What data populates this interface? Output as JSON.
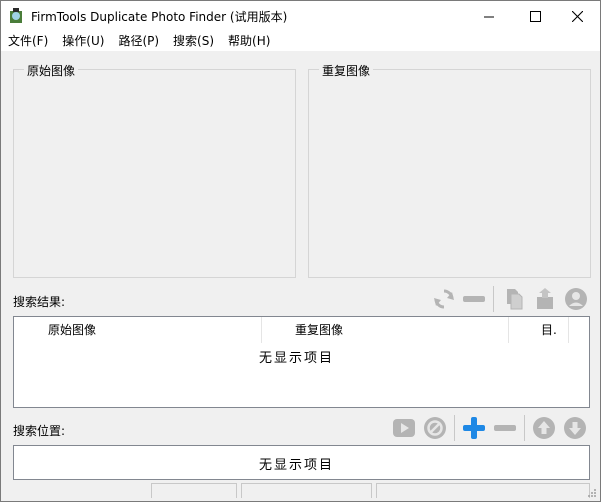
{
  "window": {
    "title": "FirmTools Duplicate Photo Finder (试用版本)"
  },
  "menu": [
    {
      "label": "文件(F)"
    },
    {
      "label": "操作(U)"
    },
    {
      "label": "路径(P)"
    },
    {
      "label": "搜索(S)"
    },
    {
      "label": "帮助(H)"
    }
  ],
  "preview": {
    "original_label": "原始图像",
    "duplicate_label": "重复图像"
  },
  "results": {
    "label": "搜索结果:",
    "columns": [
      "原始图像",
      "重复图像",
      "目."
    ],
    "empty_text": "无显示项目"
  },
  "locations": {
    "label": "搜索位置:",
    "empty_text": "无显示项目"
  },
  "colors": {
    "accent_blue": "#1e88e5",
    "disabled_gray": "#b4b4b4"
  },
  "icons": {
    "results_toolbar": [
      "refresh-icon",
      "remove-icon",
      "copy-icon",
      "move-icon",
      "person-icon"
    ],
    "locations_toolbar": [
      "play-icon",
      "cancel-icon",
      "add-icon",
      "minus-icon",
      "up-arrow-icon",
      "down-arrow-icon"
    ]
  }
}
